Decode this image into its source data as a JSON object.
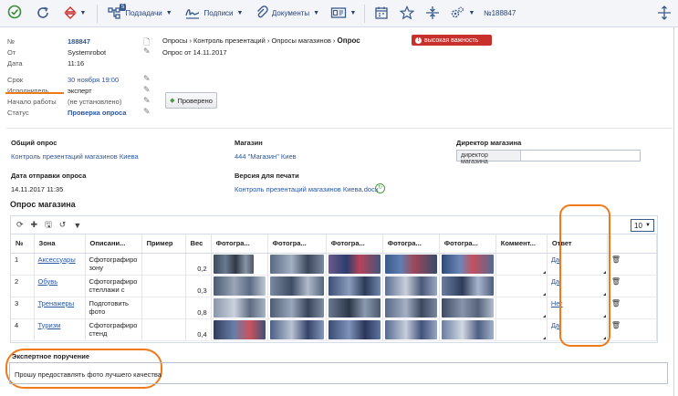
{
  "toolbar": {
    "badge_count": "5",
    "subtasks_label": "Подзадачи",
    "signatures_label": "Подписи",
    "documents_label": "Документы",
    "doc_number": "№188847"
  },
  "details": {
    "number_label": "№",
    "number_value": "188847",
    "from_label": "От",
    "from_value": "Systemrobot",
    "date_label": "Дата",
    "date_value": "11:16",
    "deadline_label": "Срок",
    "deadline_value": "30 ноября 19:00",
    "executor_label": "Исполнитель",
    "executor_value": "эксперт",
    "start_label": "Начало работы",
    "start_value": "(не установлено)",
    "status_label": "Статус",
    "status_value": "Проверка опроса"
  },
  "breadcrumb": {
    "path": "Опросы › Контроль презентаций › Опросы магазинов ›",
    "current": "Опрос"
  },
  "subtitle": "Опрос от 14.11.2017",
  "priority_label": "высокая важность",
  "checked_button": "Проверено",
  "info": {
    "general_survey_label": "Общий опрос",
    "general_survey_value": "Контроль презентаций магазинов Киева",
    "store_label": "Магазин",
    "store_value": "444 \"Магазин\" Киев",
    "director_label": "Директор магазина",
    "director_value": "директор магазина",
    "sent_date_label": "Дата отправки опроса",
    "sent_date_value": "14.11.2017 11:35",
    "print_version_label": "Версия для печати",
    "print_version_value": "Контроль презентаций магазинов Киева.docx"
  },
  "survey_title": "Опрос магазина",
  "page_size": "10",
  "columns": [
    "№",
    "Зона",
    "Описани...",
    "Пример",
    "Вес",
    "Фотогра...",
    "Фотогра...",
    "Фотогра...",
    "Фотогра...",
    "Фотогра...",
    "Коммент...",
    "Ответ",
    ""
  ],
  "rows": [
    {
      "num": "1",
      "zone": "Аксессуары",
      "desc": "Сфотографиро зону",
      "weight": "0,2",
      "answer": "Да"
    },
    {
      "num": "2",
      "zone": "Обувь",
      "desc": "Сфотографиро стеллажи с",
      "weight": "0,3",
      "answer": "Да"
    },
    {
      "num": "3",
      "zone": "Тренажеры",
      "desc": "Подготовить фото",
      "weight": "0,8",
      "answer": "Нет"
    },
    {
      "num": "4",
      "zone": "Туризм",
      "desc": "Сфотографиро стенд",
      "weight": "0,4",
      "answer": "Да"
    }
  ],
  "expert_label": "Экспертное поручение",
  "expert_text": "Прошу предоставлять фото лучшего качества",
  "colors": {
    "accent": "#2a56a3",
    "priority": "#c8302c",
    "highlight": "#f07a1a"
  }
}
